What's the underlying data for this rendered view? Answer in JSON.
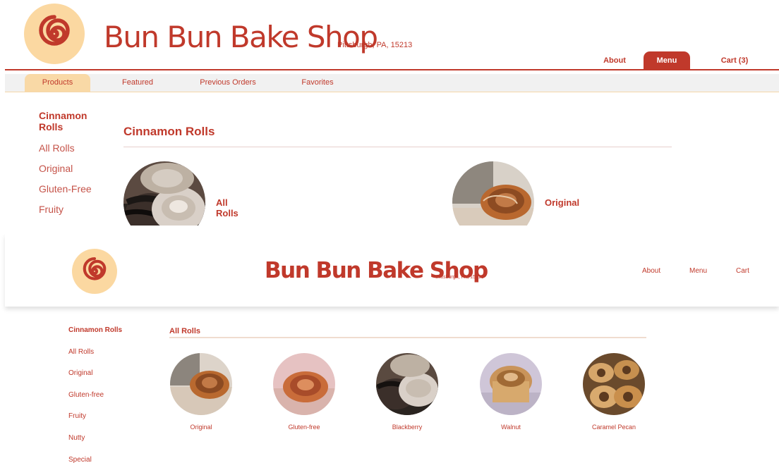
{
  "brand": {
    "name": "Bun Bun Bake Shop",
    "location": "Pittsburgh, PA, 15213"
  },
  "colors": {
    "brand_red": "#c0392b",
    "logo_peach": "#fbd8a1",
    "tab_peach": "#f9d9a6"
  },
  "screen1": {
    "nav": {
      "about": "About",
      "menu": "Menu",
      "cart": "Cart (3)",
      "active": "Menu"
    },
    "tabs": [
      "Products",
      "Featured",
      "Previous Orders",
      "Favorites"
    ],
    "active_tab": "Products",
    "sidebar": {
      "title": "Cinnamon Rolls",
      "items": [
        "All Rolls",
        "Original",
        "Gluten-Free",
        "Fruity"
      ]
    },
    "section_title": "Cinnamon Rolls",
    "cards": [
      {
        "label": "All Rolls",
        "image": "blackberry-roll-photo"
      },
      {
        "label": "Original",
        "image": "original-roll-photo"
      }
    ]
  },
  "screen2": {
    "nav": {
      "about": "About",
      "menu": "Menu",
      "cart": "Cart"
    },
    "sidebar": {
      "title": "Cinnamon Rolls",
      "items": [
        "All Rolls",
        "Original",
        "Gluten-free",
        "Fruity",
        "Nutty",
        "Special"
      ]
    },
    "section_title": "All Rolls",
    "cards": [
      {
        "label": "Original",
        "image": "original-roll-photo"
      },
      {
        "label": "Gluten-free",
        "image": "gluten-free-roll-photo"
      },
      {
        "label": "Blackberry",
        "image": "blackberry-roll-photo"
      },
      {
        "label": "Walnut",
        "image": "walnut-roll-photo"
      },
      {
        "label": "Caramel Pecan",
        "image": "caramel-pecan-roll-photo"
      }
    ]
  }
}
